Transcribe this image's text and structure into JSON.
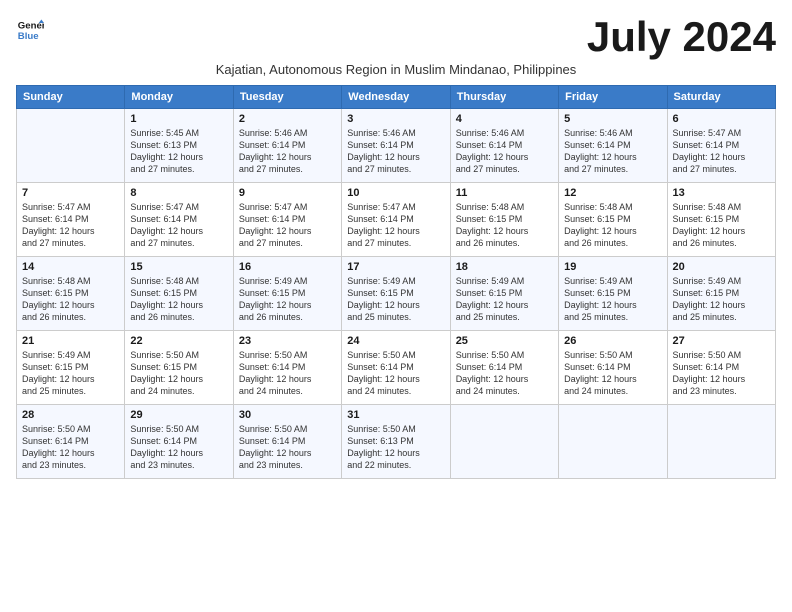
{
  "logo": {
    "line1": "General",
    "line2": "Blue"
  },
  "title": "July 2024",
  "subtitle": "Kajatian, Autonomous Region in Muslim Mindanao, Philippines",
  "days_header": [
    "Sunday",
    "Monday",
    "Tuesday",
    "Wednesday",
    "Thursday",
    "Friday",
    "Saturday"
  ],
  "weeks": [
    [
      {
        "num": "",
        "info": ""
      },
      {
        "num": "1",
        "info": "Sunrise: 5:45 AM\nSunset: 6:13 PM\nDaylight: 12 hours\nand 27 minutes."
      },
      {
        "num": "2",
        "info": "Sunrise: 5:46 AM\nSunset: 6:14 PM\nDaylight: 12 hours\nand 27 minutes."
      },
      {
        "num": "3",
        "info": "Sunrise: 5:46 AM\nSunset: 6:14 PM\nDaylight: 12 hours\nand 27 minutes."
      },
      {
        "num": "4",
        "info": "Sunrise: 5:46 AM\nSunset: 6:14 PM\nDaylight: 12 hours\nand 27 minutes."
      },
      {
        "num": "5",
        "info": "Sunrise: 5:46 AM\nSunset: 6:14 PM\nDaylight: 12 hours\nand 27 minutes."
      },
      {
        "num": "6",
        "info": "Sunrise: 5:47 AM\nSunset: 6:14 PM\nDaylight: 12 hours\nand 27 minutes."
      }
    ],
    [
      {
        "num": "7",
        "info": "Sunrise: 5:47 AM\nSunset: 6:14 PM\nDaylight: 12 hours\nand 27 minutes."
      },
      {
        "num": "8",
        "info": "Sunrise: 5:47 AM\nSunset: 6:14 PM\nDaylight: 12 hours\nand 27 minutes."
      },
      {
        "num": "9",
        "info": "Sunrise: 5:47 AM\nSunset: 6:14 PM\nDaylight: 12 hours\nand 27 minutes."
      },
      {
        "num": "10",
        "info": "Sunrise: 5:47 AM\nSunset: 6:14 PM\nDaylight: 12 hours\nand 27 minutes."
      },
      {
        "num": "11",
        "info": "Sunrise: 5:48 AM\nSunset: 6:15 PM\nDaylight: 12 hours\nand 26 minutes."
      },
      {
        "num": "12",
        "info": "Sunrise: 5:48 AM\nSunset: 6:15 PM\nDaylight: 12 hours\nand 26 minutes."
      },
      {
        "num": "13",
        "info": "Sunrise: 5:48 AM\nSunset: 6:15 PM\nDaylight: 12 hours\nand 26 minutes."
      }
    ],
    [
      {
        "num": "14",
        "info": "Sunrise: 5:48 AM\nSunset: 6:15 PM\nDaylight: 12 hours\nand 26 minutes."
      },
      {
        "num": "15",
        "info": "Sunrise: 5:48 AM\nSunset: 6:15 PM\nDaylight: 12 hours\nand 26 minutes."
      },
      {
        "num": "16",
        "info": "Sunrise: 5:49 AM\nSunset: 6:15 PM\nDaylight: 12 hours\nand 26 minutes."
      },
      {
        "num": "17",
        "info": "Sunrise: 5:49 AM\nSunset: 6:15 PM\nDaylight: 12 hours\nand 25 minutes."
      },
      {
        "num": "18",
        "info": "Sunrise: 5:49 AM\nSunset: 6:15 PM\nDaylight: 12 hours\nand 25 minutes."
      },
      {
        "num": "19",
        "info": "Sunrise: 5:49 AM\nSunset: 6:15 PM\nDaylight: 12 hours\nand 25 minutes."
      },
      {
        "num": "20",
        "info": "Sunrise: 5:49 AM\nSunset: 6:15 PM\nDaylight: 12 hours\nand 25 minutes."
      }
    ],
    [
      {
        "num": "21",
        "info": "Sunrise: 5:49 AM\nSunset: 6:15 PM\nDaylight: 12 hours\nand 25 minutes."
      },
      {
        "num": "22",
        "info": "Sunrise: 5:50 AM\nSunset: 6:15 PM\nDaylight: 12 hours\nand 24 minutes."
      },
      {
        "num": "23",
        "info": "Sunrise: 5:50 AM\nSunset: 6:14 PM\nDaylight: 12 hours\nand 24 minutes."
      },
      {
        "num": "24",
        "info": "Sunrise: 5:50 AM\nSunset: 6:14 PM\nDaylight: 12 hours\nand 24 minutes."
      },
      {
        "num": "25",
        "info": "Sunrise: 5:50 AM\nSunset: 6:14 PM\nDaylight: 12 hours\nand 24 minutes."
      },
      {
        "num": "26",
        "info": "Sunrise: 5:50 AM\nSunset: 6:14 PM\nDaylight: 12 hours\nand 24 minutes."
      },
      {
        "num": "27",
        "info": "Sunrise: 5:50 AM\nSunset: 6:14 PM\nDaylight: 12 hours\nand 23 minutes."
      }
    ],
    [
      {
        "num": "28",
        "info": "Sunrise: 5:50 AM\nSunset: 6:14 PM\nDaylight: 12 hours\nand 23 minutes."
      },
      {
        "num": "29",
        "info": "Sunrise: 5:50 AM\nSunset: 6:14 PM\nDaylight: 12 hours\nand 23 minutes."
      },
      {
        "num": "30",
        "info": "Sunrise: 5:50 AM\nSunset: 6:14 PM\nDaylight: 12 hours\nand 23 minutes."
      },
      {
        "num": "31",
        "info": "Sunrise: 5:50 AM\nSunset: 6:13 PM\nDaylight: 12 hours\nand 22 minutes."
      },
      {
        "num": "",
        "info": ""
      },
      {
        "num": "",
        "info": ""
      },
      {
        "num": "",
        "info": ""
      }
    ]
  ]
}
